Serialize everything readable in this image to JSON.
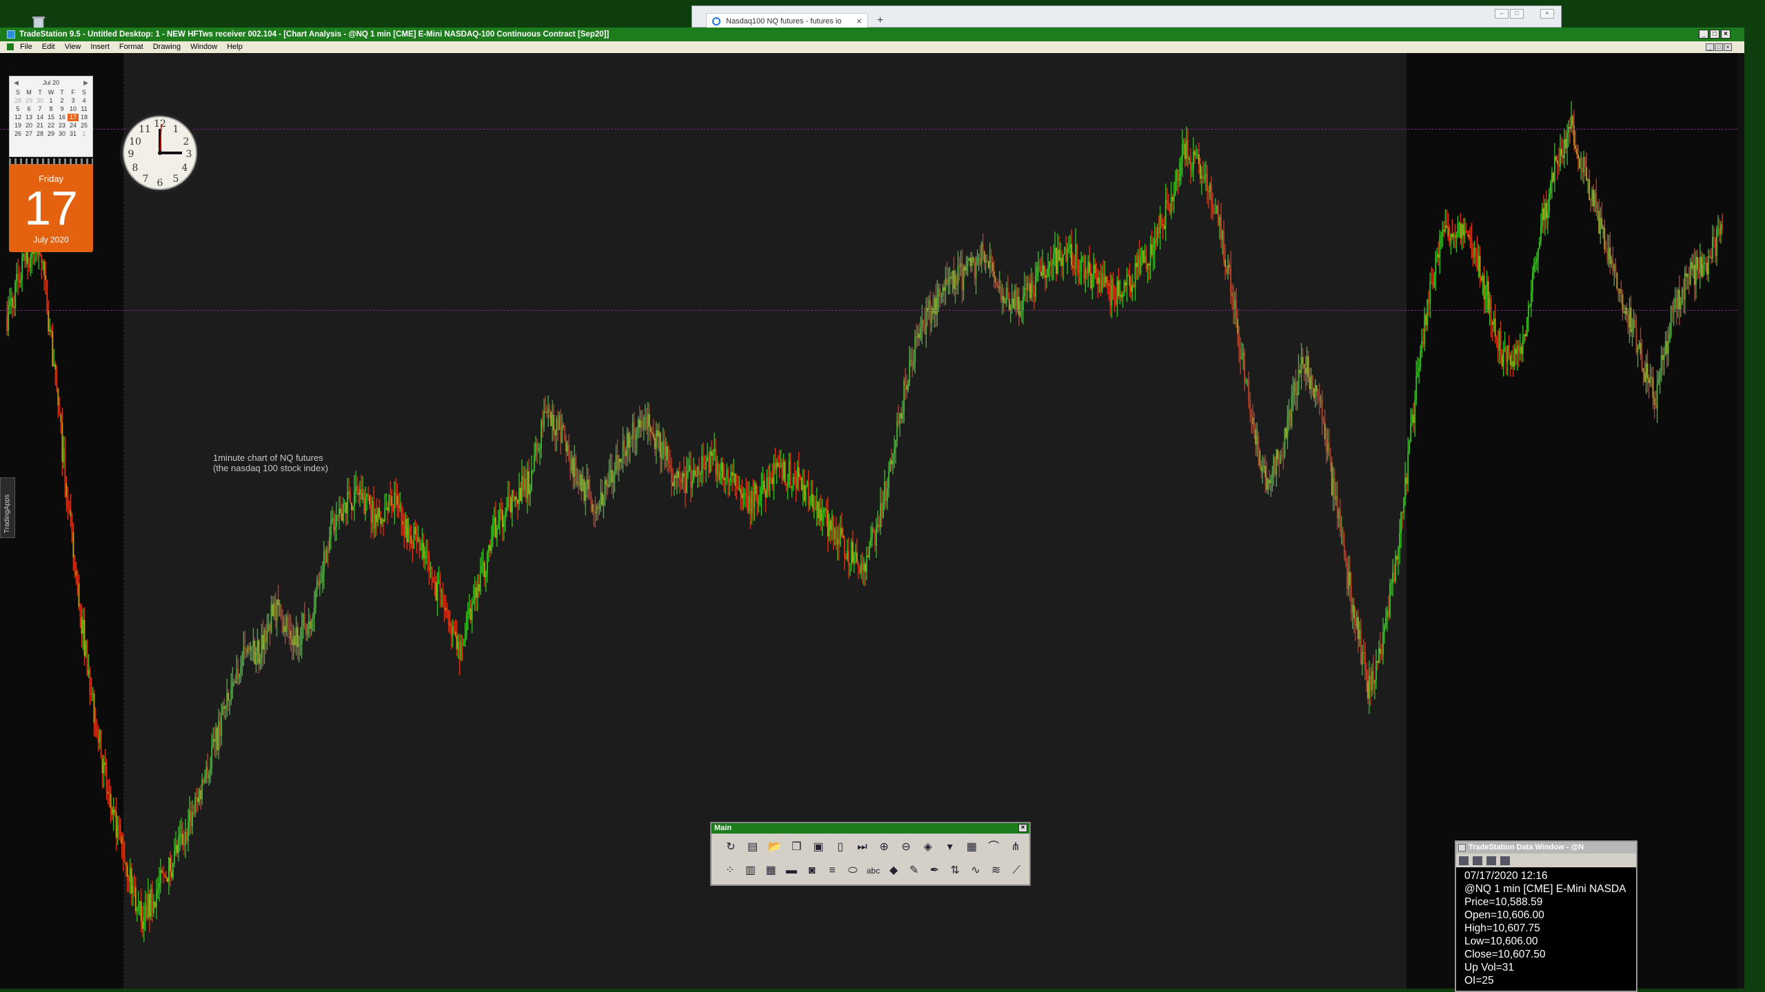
{
  "browser": {
    "tab_title": "Nasdaq100 NQ futures - futures io",
    "tab_close": "×",
    "new_tab": "+"
  },
  "window": {
    "title": "TradeStation 9.5 - Untitled Desktop: 1 - NEW HFTws receiver 002.104 - [Chart Analysis - @NQ 1 min [CME] E-Mini NASDAQ-100 Continuous Contract [Sep20]]",
    "controls": {
      "minimize": "_",
      "maximize": "□",
      "close": "×"
    }
  },
  "menu": [
    "File",
    "Edit",
    "View",
    "Insert",
    "Format",
    "Drawing",
    "Window",
    "Help"
  ],
  "calendar": {
    "month_label": "Jul 20",
    "weekdays": [
      "S",
      "M",
      "T",
      "W",
      "T",
      "F",
      "S"
    ],
    "days": [
      "28",
      "29",
      "30",
      "1",
      "2",
      "3",
      "4",
      "5",
      "6",
      "7",
      "8",
      "9",
      "10",
      "11",
      "12",
      "13",
      "14",
      "15",
      "16",
      "17",
      "18",
      "19",
      "20",
      "21",
      "22",
      "23",
      "24",
      "25",
      "26",
      "27",
      "28",
      "29",
      "30",
      "31",
      "1"
    ],
    "today": "17"
  },
  "datecard": {
    "dow": "Friday",
    "day": "17",
    "month_year": "July 2020"
  },
  "sidebar_label": "TradingApps",
  "chart_note": {
    "line1": "1minute chart of NQ futures",
    "line2": "(the nasdaq 100 stock index)"
  },
  "palette": {
    "title": "Main",
    "close": "×",
    "row1": [
      "refresh-icon",
      "format-window-icon",
      "open-folder-icon",
      "copy-icon",
      "new-window-icon",
      "new-document-icon",
      "play-end-icon",
      "zoom-in-icon",
      "zoom-out-icon",
      "indicator-icon",
      "dropdown-icon",
      "grid-icon",
      "curve-icon",
      "pitchfork-icon"
    ],
    "row2": [
      "scatter-icon",
      "print-preview-icon",
      "table-icon",
      "color-bars-icon",
      "camera-icon",
      "lines-icon",
      "ellipse-icon",
      "text-icon",
      "eraser-icon",
      "pencil-icon",
      "pen-icon",
      "levels-icon",
      "fib-icon",
      "waves-icon",
      "trendline-icon"
    ]
  },
  "data_window": {
    "title": "TradeStation Data Window - @N",
    "datetime": "07/17/2020 12:16",
    "symbol": "@NQ 1 min [CME] E-Mini NASDA",
    "price": "Price=10,588.59",
    "open": "Open=10,606.00",
    "high": "High=10,607.75",
    "low": "Low=10,606.00",
    "close": "Close=10,607.50",
    "upvol": "Up Vol=31",
    "oi": "OI=25"
  },
  "colors": {
    "up_bar": "#3fbf2a",
    "down_bar": "#d63a1a",
    "title_green": "#1d7d1d",
    "session_bg": "#1c1c1c",
    "date_card": "#e3610f"
  },
  "chart_data": {
    "type": "candlestick",
    "symbol": "@NQ 1 min",
    "series_shape_close": [
      10560,
      10585,
      10595,
      10520,
      10440,
      10380,
      10330,
      10300,
      10270,
      10285,
      10300,
      10320,
      10345,
      10370,
      10395,
      10400,
      10420,
      10405,
      10415,
      10450,
      10470,
      10475,
      10462,
      10470,
      10455,
      10440,
      10420,
      10400,
      10430,
      10458,
      10470,
      10480,
      10510,
      10505,
      10480,
      10470,
      10485,
      10502,
      10510,
      10495,
      10478,
      10485,
      10492,
      10480,
      10470,
      10478,
      10486,
      10482,
      10472,
      10458,
      10446,
      10440,
      10465,
      10510,
      10545,
      10565,
      10575,
      10580,
      10590,
      10575,
      10565,
      10575,
      10584,
      10592,
      10585,
      10575,
      10570,
      10580,
      10590,
      10612,
      10640,
      10632,
      10610,
      10565,
      10510,
      10480,
      10500,
      10540,
      10520,
      10470,
      10420,
      10380,
      10410,
      10470,
      10540,
      10590,
      10605,
      10596,
      10570,
      10540,
      10540,
      10595,
      10630,
      10650,
      10625,
      10598,
      10570,
      10545,
      10520,
      10560,
      10580,
      10585,
      10600
    ]
  }
}
